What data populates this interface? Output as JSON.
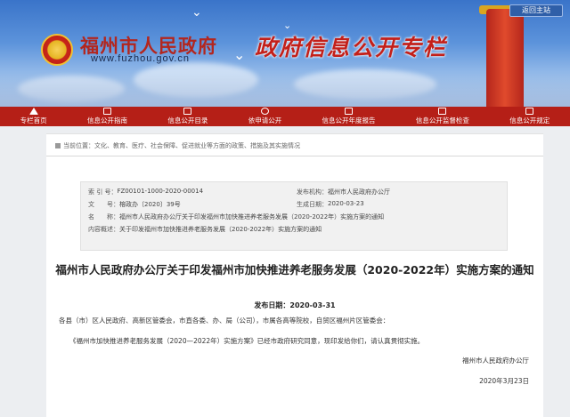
{
  "header": {
    "back_label": "返回主站",
    "site_title": "福州市人民政府",
    "site_url": "www.fuzhou.gov.cn",
    "special_title": "政府信息公开专栏"
  },
  "nav": [
    {
      "label": "专栏首页",
      "icon": "home-icon"
    },
    {
      "label": "信息公开指南",
      "icon": "book-icon"
    },
    {
      "label": "信息公开目录",
      "icon": "list-icon"
    },
    {
      "label": "依申请公开",
      "icon": "person-icon"
    },
    {
      "label": "信息公开年度报告",
      "icon": "folder-icon"
    },
    {
      "label": "信息公开监督检查",
      "icon": "calendar-icon"
    },
    {
      "label": "信息公开规定",
      "icon": "document-icon"
    }
  ],
  "breadcrumb": {
    "prefix": "当前位置：",
    "items": [
      "文化、教育、医疗、社会保障、促进就业等方面的政策、措施及其实施情况"
    ]
  },
  "meta": {
    "index_label": "索 引 号：",
    "index_value": "FZ00101-1000-2020-00014",
    "publisher_label": "发布机构：",
    "publisher_value": "福州市人民政府办公厅",
    "docno_label": "文　　号：",
    "docno_value": "榕政办〔2020〕39号",
    "created_label": "生成日期：",
    "created_value": "2020-03-23",
    "name_label": "名　　称：",
    "name_value": "福州市人民政府办公厅关于印发福州市加快推进养老服务发展（2020-2022年）实施方案的通知",
    "summary_label": "内容概述：",
    "summary_value": "关于印发福州市加快推进养老服务发展（2020-2022年）实施方案的通知"
  },
  "document": {
    "title": "福州市人民政府办公厅关于印发福州市加快推进养老服务发展（2020-2022年）实施方案的通知",
    "date_label": "发布日期：",
    "date_value": "2020-03-31",
    "addressee": "各县（市）区人民政府、高新区管委会，市直各委、办、局（公司），市属各高等院校，自贸区福州片区管委会：",
    "body": "《福州市加快推进养老服务发展（2020—2022年）实施方案》已经市政府研究同意，现印发给你们，请认真贯彻实施。",
    "signature": "福州市人民政府办公厅",
    "sign_date": "2020年3月23日"
  },
  "colors": {
    "nav_bg": "#b51f17",
    "title_red": "#b3261e",
    "banner_blue": "#3a74c9"
  }
}
